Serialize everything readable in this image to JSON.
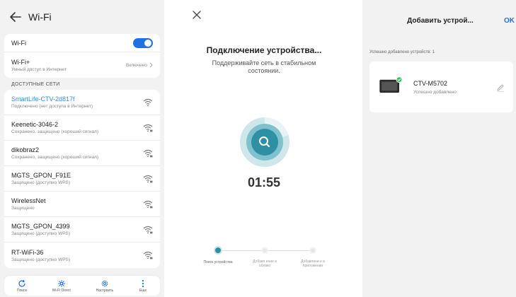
{
  "wifi_settings": {
    "title": "Wi-Fi",
    "wifi_toggle": {
      "label": "Wi-Fi",
      "on": true
    },
    "wifi_plus": {
      "label": "Wi-Fi+",
      "sub": "Умный доступ в Интернет",
      "state": "Включено"
    },
    "section_title": "ДОСТУПНЫЕ СЕТИ",
    "networks": [
      {
        "name": "SmartLife-CTV-2d817f",
        "status": "Подключено (нет доступа в Интернет)",
        "active": true
      },
      {
        "name": "Keenetic-3046-2",
        "status": "Сохранено, защищено (хороший сигнал)",
        "active": false
      },
      {
        "name": "dikobraz2",
        "status": "Сохранено, защищено (хороший сигнал)",
        "active": false
      },
      {
        "name": "MGTS_GPON_F91E",
        "status": "Защищено (доступно WPS)",
        "active": false
      },
      {
        "name": "WirelessNet",
        "status": "Защищено",
        "active": false
      },
      {
        "name": "MGTS_GPON_4399",
        "status": "Защищено (доступно WPS)",
        "active": false
      },
      {
        "name": "RT-WiFi-36",
        "status": "Защищено (доступно WPS)",
        "active": false
      }
    ],
    "bottom_nav": [
      {
        "label": "Поиск",
        "icon": "refresh-icon"
      },
      {
        "label": "Wi-Fi Direct",
        "icon": "wifi-direct-icon"
      },
      {
        "label": "Настроить",
        "icon": "gear-icon"
      },
      {
        "label": "Еще",
        "icon": "more-icon"
      }
    ],
    "accent_color": "#1e6fe8"
  },
  "connecting": {
    "title": "Подключение устройства...",
    "subtitle": "Поддерживайте сеть в стабильном состоянии.",
    "timer": "01:55",
    "steps": [
      {
        "label": "Поиск устройства",
        "active": true
      },
      {
        "label": "Добавл ение в облако",
        "active": false
      },
      {
        "label": "Добавлени е в приложении",
        "active": false
      }
    ],
    "accent_color": "#2f8fa3"
  },
  "add_device": {
    "title": "Добавить устрой...",
    "ok_label": "OK",
    "status_text": "Успешно добавлено устройств: 1",
    "device": {
      "name": "CTV-M5702",
      "status": "Успешно добавлено"
    },
    "success_color": "#2ec05a"
  }
}
